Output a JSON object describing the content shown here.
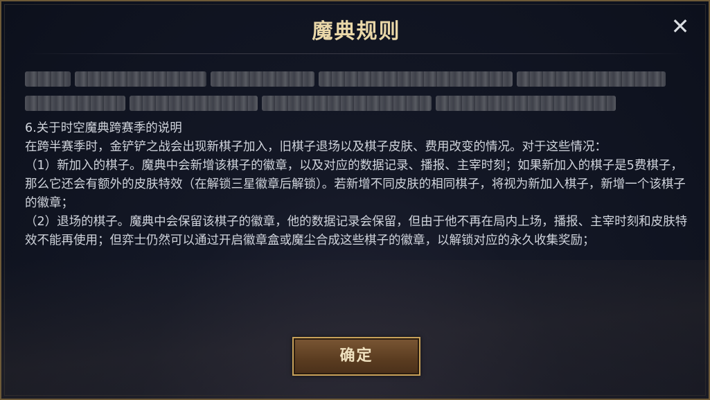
{
  "dialog": {
    "title": "魔典规则",
    "close_label": "✕",
    "section_heading": "6.关于时空魔典跨赛季的说明",
    "paragraphs": [
      "在跨半赛季时，金铲铲之战会出现新棋子加入，旧棋子退场以及棋子皮肤、费用改变的情况。对于这些情况：",
      "（1）新加入的棋子。魔典中会新增该棋子的徽章，以及对应的数据记录、播报、主宰时刻；如果新加入的棋子是5费棋子，那么它还会有额外的皮肤特效（在解锁三星徽章后解锁）。若新增不同皮肤的相同棋子，将视为新加入棋子，新增一个该棋子的徽章；",
      "（2）退场的棋子。魔典中会保留该棋子的徽章，他的数据记录会保留，但由于他不再在局内上场，播报、主宰时刻和皮肤特效不能再使用；但弈士仍然可以通过开启徽章盒或魔尘合成这些棋子的徽章，以解锁对应的永久收集奖励；"
    ],
    "confirm_label": "确定"
  }
}
